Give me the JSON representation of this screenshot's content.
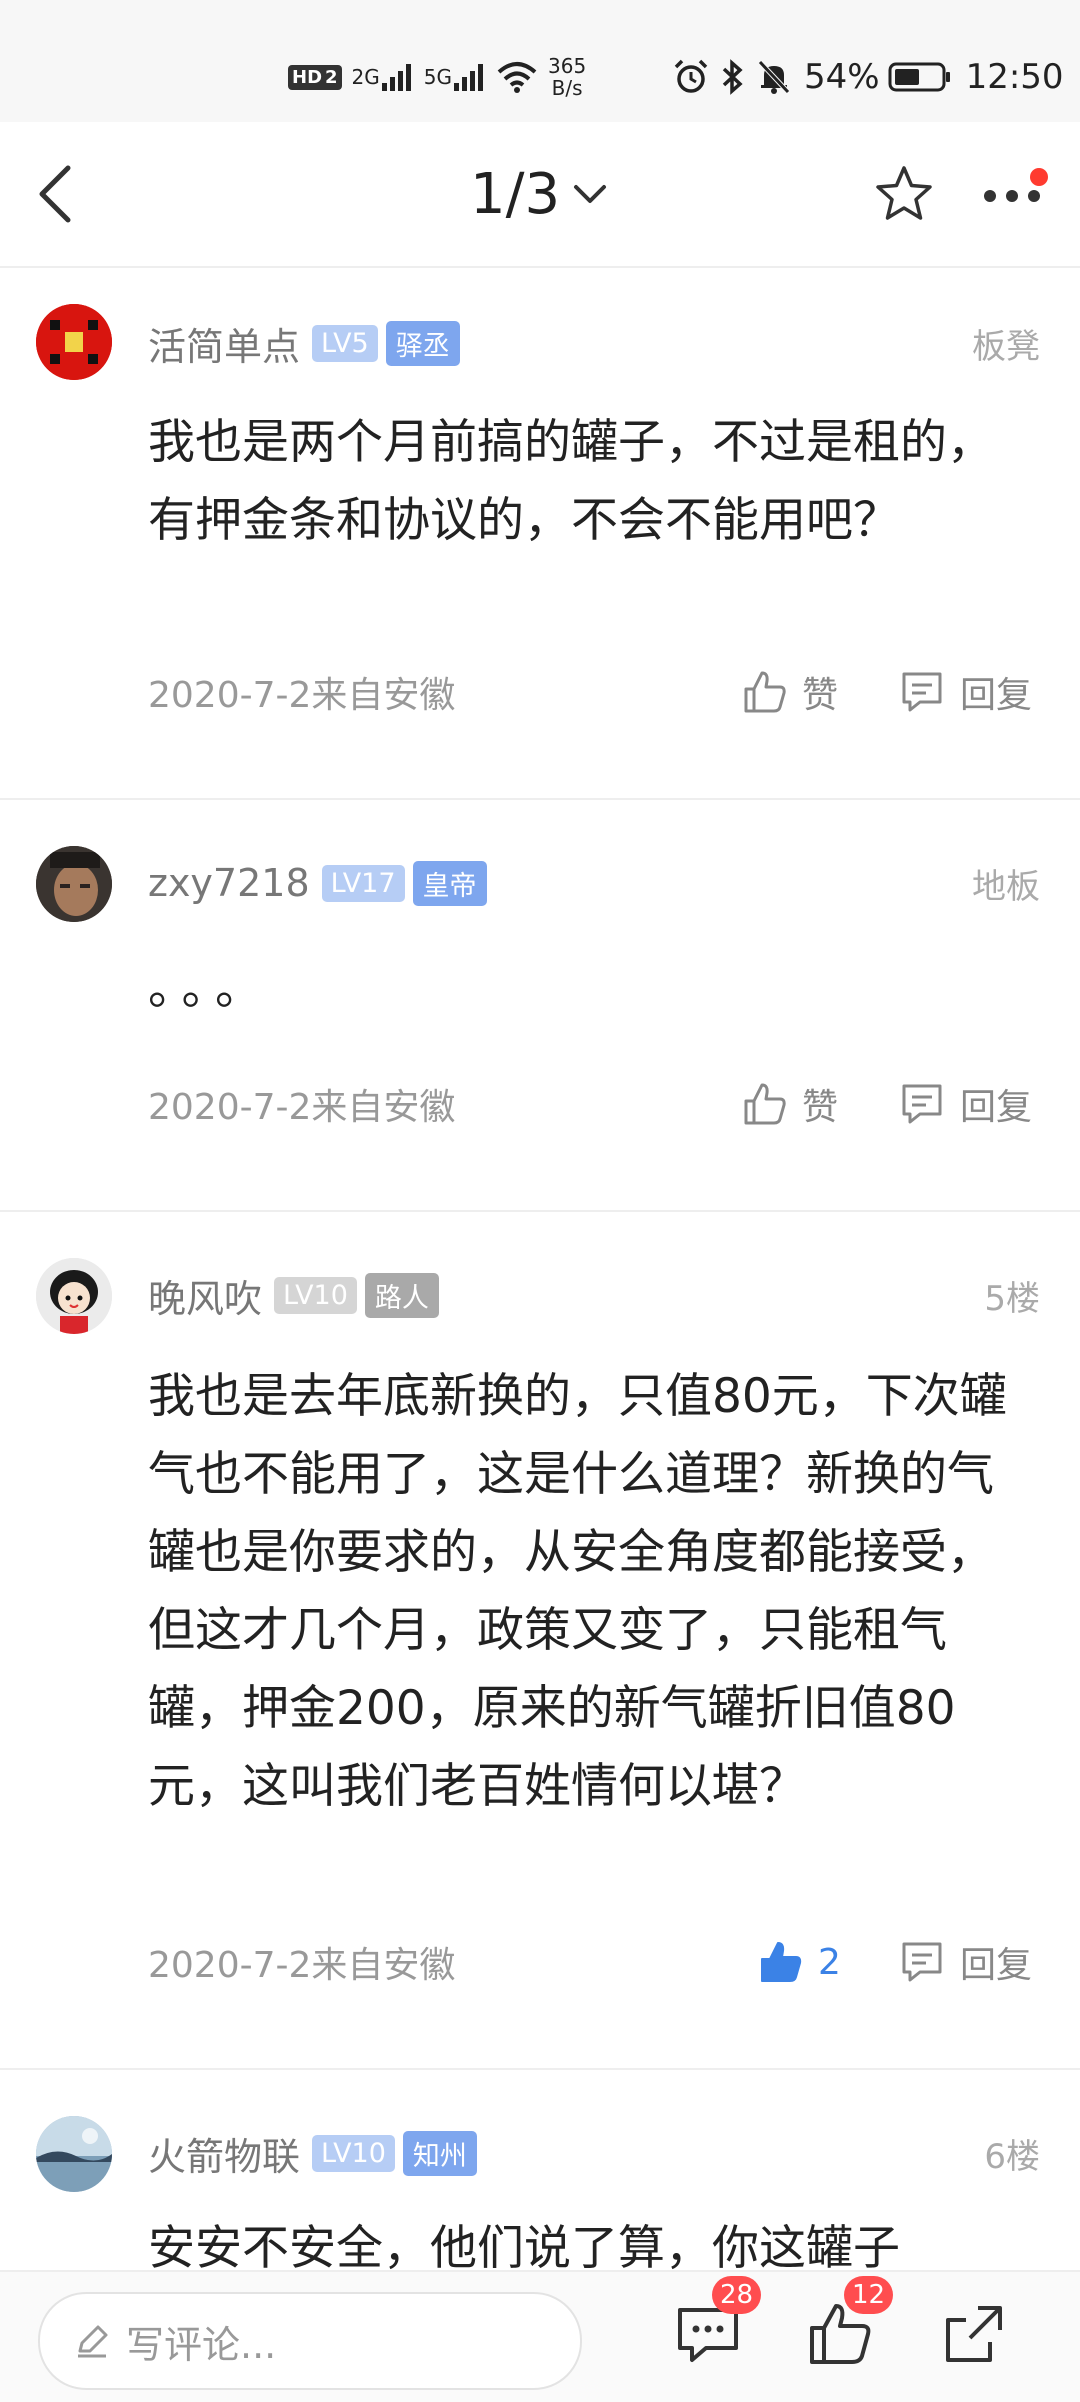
{
  "status_bar": {
    "hd_label": "HD",
    "hd_num": "2",
    "net_2g": "2G",
    "net_5g": "5G",
    "speed_value": "365",
    "speed_unit": "B/s",
    "battery": "54%",
    "time": "12:50"
  },
  "nav": {
    "page_indicator": "1/3"
  },
  "posts": [
    {
      "username": "活简单点",
      "level": "LV5",
      "title": "驿丞",
      "floor": "板凳",
      "content": "我也是两个月前搞的罐子，不过是租的， 有押金条和协议的，不会不能用吧？",
      "meta": "2020-7-2来自安徽",
      "like_label": "赞",
      "reply_label": "回复"
    },
    {
      "username": "zxy7218",
      "level": "LV17",
      "title": "皇帝",
      "floor": "地板",
      "content": "。。。",
      "meta": "2020-7-2来自安徽",
      "like_label": "赞",
      "reply_label": "回复"
    },
    {
      "username": "晚风吹",
      "level": "LV10",
      "title": "路人",
      "floor": "5楼",
      "content": "我也是去年底新换的，只值80元，下次罐气也不能用了，这是什么道理？新换的气罐也是你要求的，从安全角度都能接受，但这才几个月，政策又变了，只能租气罐，押金200，原来的新气罐折旧值80元，这叫我们老百姓情何以堪？",
      "meta": "2020-7-2来自安徽",
      "like_label": "2",
      "reply_label": "回复"
    },
    {
      "username": "火箭物联",
      "level": "LV10",
      "title": "知州",
      "floor": "6楼",
      "content": "安安不安全，他们说了算，你这罐子"
    }
  ],
  "bottom_bar": {
    "comment_placeholder": "写评论...",
    "comment_count": "28",
    "like_count": "12"
  },
  "colors": {
    "accent": "#3b82e6",
    "badge_red": "#ff4d4f",
    "level_badge": "#b6cdf5",
    "title_badge": "#7ea6ee"
  },
  "icons": [
    "back-icon",
    "chevron-down-icon",
    "star-icon",
    "more-icon",
    "thumbs-up-icon",
    "reply-icon",
    "pencil-icon",
    "comment-icon",
    "share-icon",
    "alarm-icon",
    "bluetooth-icon",
    "mute-icon",
    "wifi-icon",
    "signal-icon",
    "battery-icon"
  ]
}
